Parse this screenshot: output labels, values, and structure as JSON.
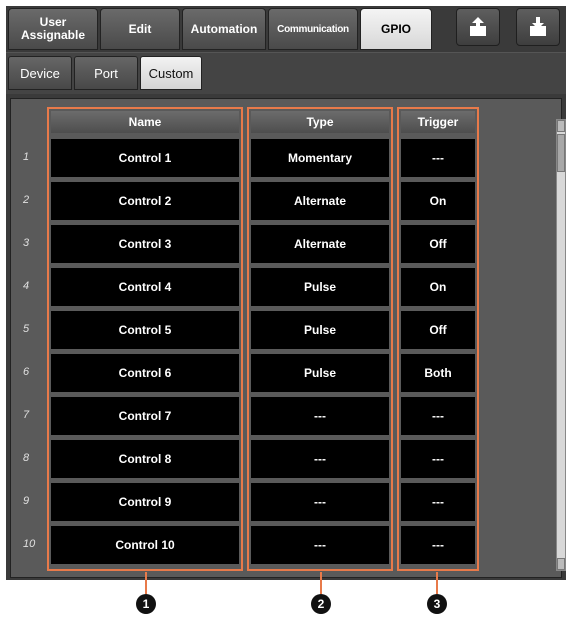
{
  "tabs": [
    {
      "label_line1": "User",
      "label_line2": "Assignable",
      "active": false
    },
    {
      "label": "Edit",
      "active": false
    },
    {
      "label": "Automation",
      "active": false
    },
    {
      "label": "Communication",
      "active": false
    },
    {
      "label": "GPIO",
      "active": true
    }
  ],
  "icons": {
    "upload": "export-icon",
    "download": "import-icon"
  },
  "subtabs": [
    {
      "label": "Device",
      "active": false
    },
    {
      "label": "Port",
      "active": false
    },
    {
      "label": "Custom",
      "active": true
    }
  ],
  "table": {
    "headers": {
      "name": "Name",
      "type": "Type",
      "trigger": "Trigger"
    },
    "rows": [
      {
        "num": "1",
        "name": "Control 1",
        "type": "Momentary",
        "trigger": "---"
      },
      {
        "num": "2",
        "name": "Control 2",
        "type": "Alternate",
        "trigger": "On"
      },
      {
        "num": "3",
        "name": "Control 3",
        "type": "Alternate",
        "trigger": "Off"
      },
      {
        "num": "4",
        "name": "Control 4",
        "type": "Pulse",
        "trigger": "On"
      },
      {
        "num": "5",
        "name": "Control 5",
        "type": "Pulse",
        "trigger": "Off"
      },
      {
        "num": "6",
        "name": "Control 6",
        "type": "Pulse",
        "trigger": "Both"
      },
      {
        "num": "7",
        "name": "Control 7",
        "type": "---",
        "trigger": "---"
      },
      {
        "num": "8",
        "name": "Control 8",
        "type": "---",
        "trigger": "---"
      },
      {
        "num": "9",
        "name": "Control 9",
        "type": "---",
        "trigger": "---"
      },
      {
        "num": "10",
        "name": "Control 10",
        "type": "---",
        "trigger": "---"
      }
    ]
  },
  "callouts": [
    "1",
    "2",
    "3"
  ],
  "colors": {
    "highlight": "#e87a4a",
    "cell_bg": "#000000",
    "panel_bg": "#5a5a5a"
  }
}
